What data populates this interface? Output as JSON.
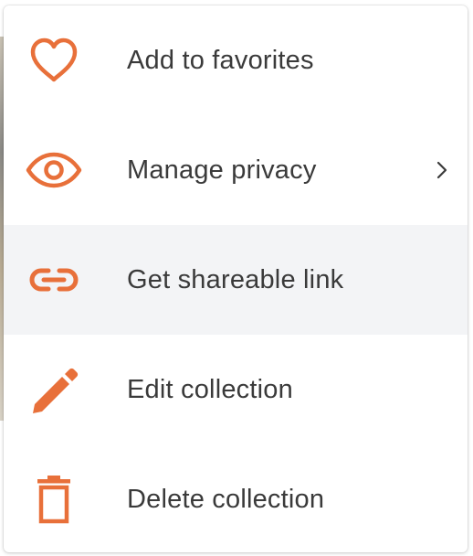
{
  "menu": {
    "accent_color": "#e8703a",
    "highlight_color": "#f3f4f6",
    "items": [
      {
        "label": "Add to favorites",
        "icon": "heart-icon",
        "has_submenu": false,
        "highlighted": false
      },
      {
        "label": "Manage privacy",
        "icon": "eye-icon",
        "has_submenu": true,
        "submenu_icon": "chevron-right-icon",
        "highlighted": false
      },
      {
        "label": "Get shareable link",
        "icon": "link-icon",
        "has_submenu": false,
        "highlighted": true
      },
      {
        "label": "Edit collection",
        "icon": "pencil-icon",
        "has_submenu": false,
        "highlighted": false
      },
      {
        "label": "Delete collection",
        "icon": "trash-icon",
        "has_submenu": false,
        "highlighted": false
      }
    ]
  }
}
